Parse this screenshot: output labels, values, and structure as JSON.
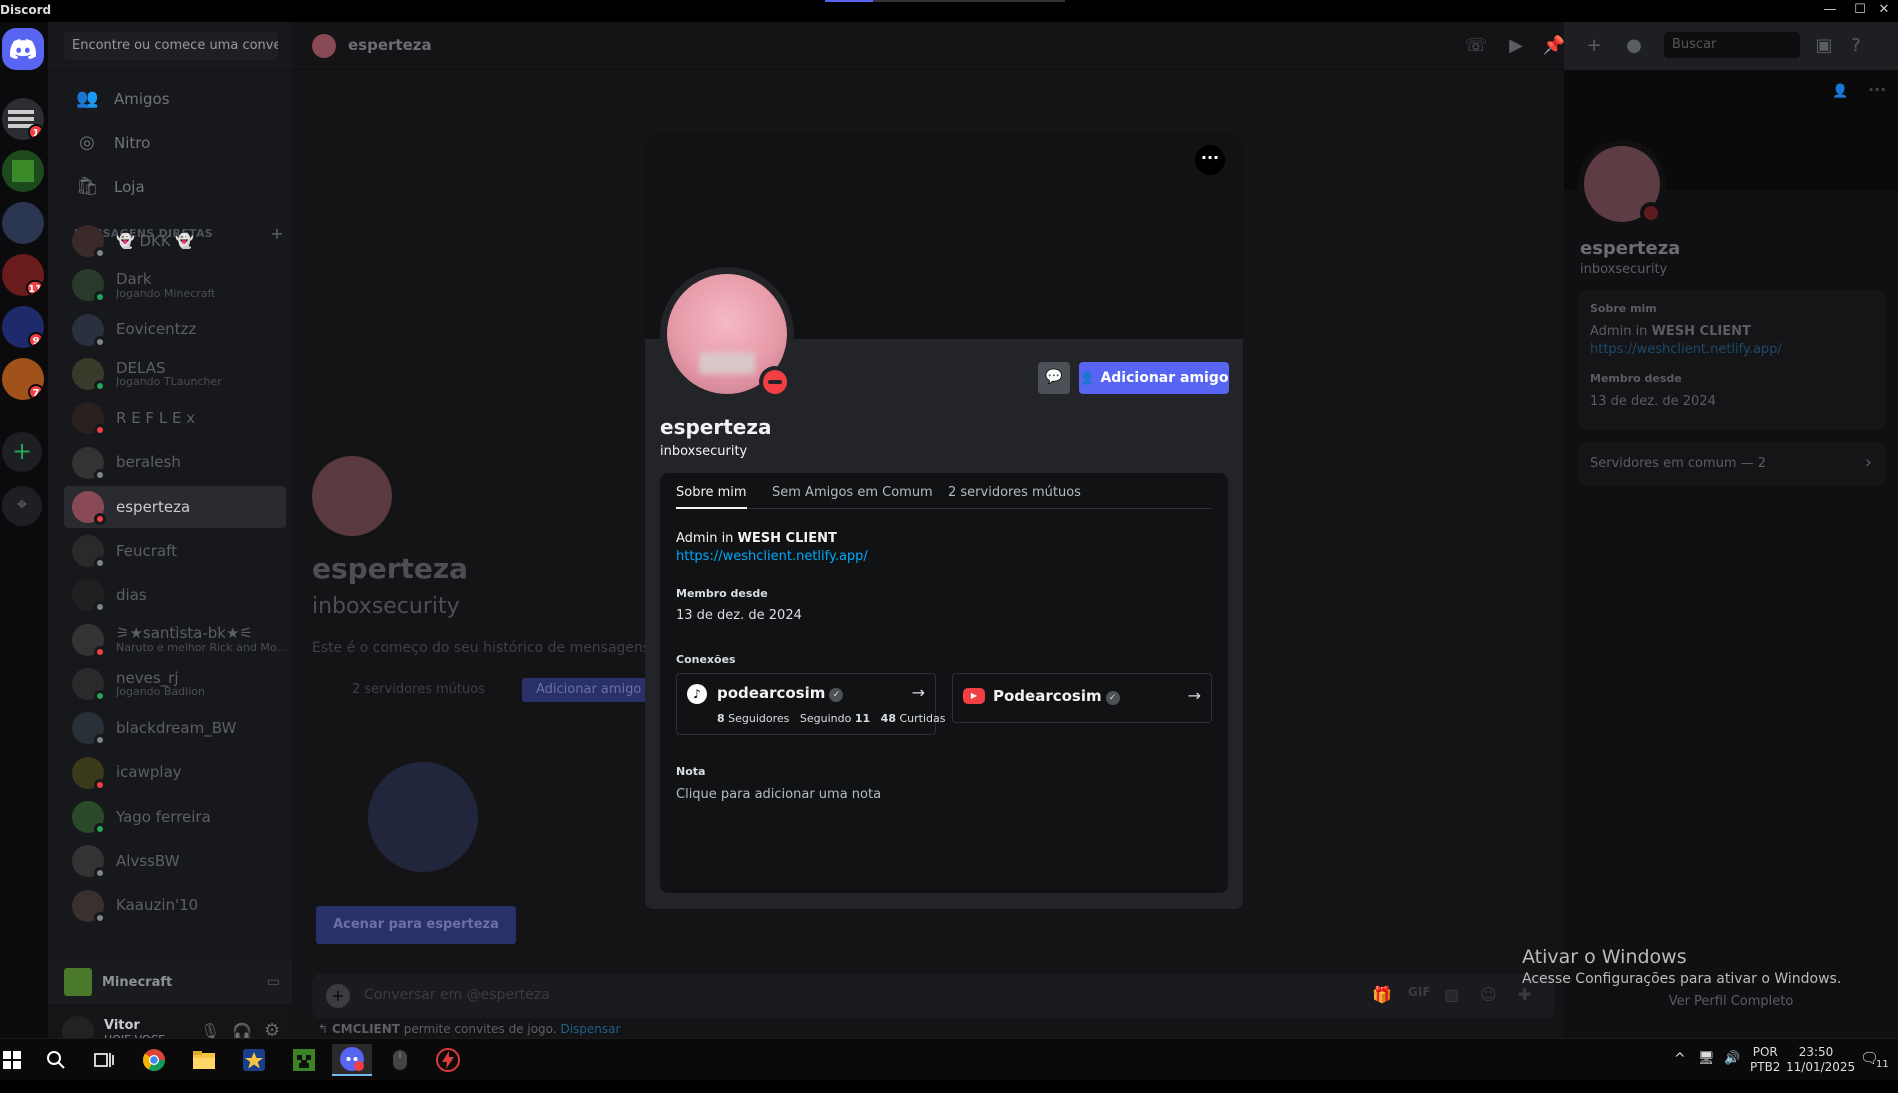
{
  "window": {
    "title": "Discord",
    "minimize": "—",
    "maximize": "☐",
    "close": "✕"
  },
  "rail": {
    "servers": [
      {
        "name": "Servidor 1",
        "badge": "1"
      },
      {
        "name": "Servidor 2",
        "badge": ""
      },
      {
        "name": "Servidor 3",
        "badge": ""
      },
      {
        "name": "Servidor 4",
        "badge": "11"
      },
      {
        "name": "Servidor 5",
        "badge": "9"
      },
      {
        "name": "Servidor 6",
        "badge": "7"
      }
    ],
    "add": "+",
    "explore": "⌖"
  },
  "dm_sidebar": {
    "search_placeholder": "Encontre ou comece uma conversa",
    "nav": [
      {
        "label": "Amigos",
        "icon": "👥"
      },
      {
        "label": "Nitro",
        "icon": "◎"
      },
      {
        "label": "Loja",
        "icon": "🛍"
      }
    ],
    "header": "MENSAGENS DIRETAS",
    "header_add": "+",
    "dms": [
      {
        "name": "👻 DKK 👻",
        "sub": "",
        "status": "off"
      },
      {
        "name": "Dark",
        "sub": "Jogando Minecraft",
        "status": "on"
      },
      {
        "name": "Eovicentzz",
        "sub": "",
        "status": "off"
      },
      {
        "name": "DELAS",
        "sub": "Jogando TLauncher",
        "status": "on"
      },
      {
        "name": "R E F L E x",
        "sub": "",
        "status": "dnd"
      },
      {
        "name": "beralesh",
        "sub": "",
        "status": "off"
      },
      {
        "name": "esperteza",
        "sub": "",
        "status": "dnd",
        "active": true
      },
      {
        "name": "Feucraft",
        "sub": "",
        "status": "off"
      },
      {
        "name": "dias",
        "sub": "",
        "status": "off"
      },
      {
        "name": "⚞★santista-bk★⚟",
        "sub": "Naruto e melhor Rick and Mo...",
        "status": "dnd"
      },
      {
        "name": "neves_rj",
        "sub": "Jogando Badlion",
        "status": "on"
      },
      {
        "name": "blackdream_BW",
        "sub": "",
        "status": "off"
      },
      {
        "name": "icawplay",
        "sub": "",
        "status": "dnd"
      },
      {
        "name": "Yago ferreira",
        "sub": "",
        "status": "on"
      },
      {
        "name": "AlvssBW",
        "sub": "",
        "status": "off"
      },
      {
        "name": "Kaauzin'10",
        "sub": "",
        "status": "off"
      }
    ],
    "voice_label": "Minecraft",
    "user": {
      "name": "Vitor",
      "status": "HOJE VOCE ..."
    }
  },
  "chat": {
    "header_name": "esperteza",
    "search_placeholder": "Buscar",
    "intro_name": "esperteza",
    "intro_user": "inboxsecurity",
    "intro_text": "Este é o começo do seu histórico de mensagens c",
    "mutual": "2 servidores mútuos",
    "add_friend": "Adicionar amigo",
    "wave_button": "Acenar para esperteza",
    "composer_placeholder": "Conversar em @esperteza",
    "invite_notice": "CMCLIENT",
    "invite_text": " permite convites de jogo.",
    "dismiss": "Dispensar"
  },
  "right_panel": {
    "name": "esperteza",
    "user": "inboxsecurity",
    "about_title": "Sobre mim",
    "bio_prefix": "Admin in ",
    "bio_bold": "WESH CLIENT",
    "link": "https://weshclient.netlify.app/",
    "member_title": "Membro desde",
    "member_since": "13 de dez. de 2024",
    "mutual_servers": "Servidores em comum — 2",
    "full_profile": "Ver Perfil Completo"
  },
  "modal": {
    "name": "esperteza",
    "user": "inboxsecurity",
    "add_friend": "Adicionar amigo",
    "tabs": [
      "Sobre mim",
      "Sem Amigos em Comum",
      "2 servidores mútuos"
    ],
    "bio_prefix": "Admin in ",
    "bio_bold": "WESH CLIENT",
    "link": "https://weshclient.netlify.app/",
    "member_title": "Membro desde",
    "member_since": "13 de dez. de 2024",
    "connections_title": "Conexões",
    "connections": [
      {
        "service": "tiktok",
        "name": "podearcosim",
        "followers_n": "8",
        "followers_l": " Seguidores",
        "following_l": "Seguindo ",
        "following_n": "11",
        "likes_n": "48",
        "likes_l": " Curtidas"
      },
      {
        "service": "youtube",
        "name": "Podearcosim"
      }
    ],
    "note_title": "Nota",
    "note_placeholder": "Clique para adicionar uma nota",
    "more": "···"
  },
  "watermark": {
    "line1": "Ativar o Windows",
    "line2": "Acesse Configurações para ativar o Windows."
  },
  "taskbar": {
    "lang1": "POR",
    "lang2": "PTB2",
    "time": "23:50",
    "date": "11/01/2025",
    "notif": "11"
  },
  "colors": {
    "accent": "#5865f2",
    "dnd": "#f23f43",
    "online": "#23a55a",
    "link": "#00a8fc"
  }
}
